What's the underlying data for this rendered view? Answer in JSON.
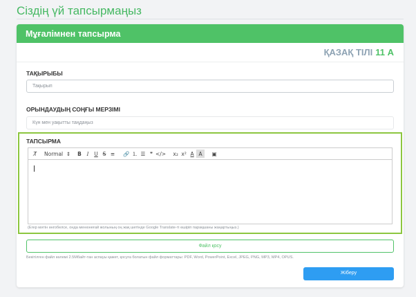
{
  "page": {
    "title": "Сіздің үй тапсырмаңыз"
  },
  "card": {
    "header": "Мұғалімнен тапсырма",
    "subject": "ҚАЗАҚ ТІЛІ",
    "grade": "11 А"
  },
  "topic": {
    "label": "ТАҚЫРЫБЫ",
    "placeholder": "Тақырып"
  },
  "deadline": {
    "label": "ОРЫНДАУДЫҢ СОҢҒЫ МЕРЗІМІ",
    "placeholder": "Күн мен уақытты таңдаңыз"
  },
  "task": {
    "label": "ТАПСЫРМА",
    "hint": "(Егер мәтін өнгобелсе, онда менюнеғай жолының оң жақ шетінде Google Translate-ті өшіріп парақшаны жаңартыңыз.)"
  },
  "toolbar": {
    "clear_format": "T̸",
    "style_select": "Normal",
    "select_arrows": "⇕",
    "bold": "B",
    "italic": "I",
    "underline": "U",
    "strike": "S",
    "align": "≡",
    "link": "🔗",
    "ordered_list": "⒈",
    "bullet_list": "☰",
    "quote": "❞",
    "code": "</>",
    "subscript": "x₂",
    "superscript": "x²",
    "font_color": "A",
    "background_color": "A",
    "video": "▣"
  },
  "file": {
    "button_label": "Файл қосу",
    "note": "Бекітілген файл көлемі 2.5Мбайт-тан аспауы қажет, қосуға болатын файл форматтары: PDF, Word, PowerPoint, Excel, JPEG, PNG, MP3, MP4, OPUS."
  },
  "submit": {
    "label": "Жіберу"
  },
  "colors": {
    "accent_green": "#4fc267",
    "highlight_border": "#8cc63f",
    "send_blue": "#2e9df2"
  }
}
